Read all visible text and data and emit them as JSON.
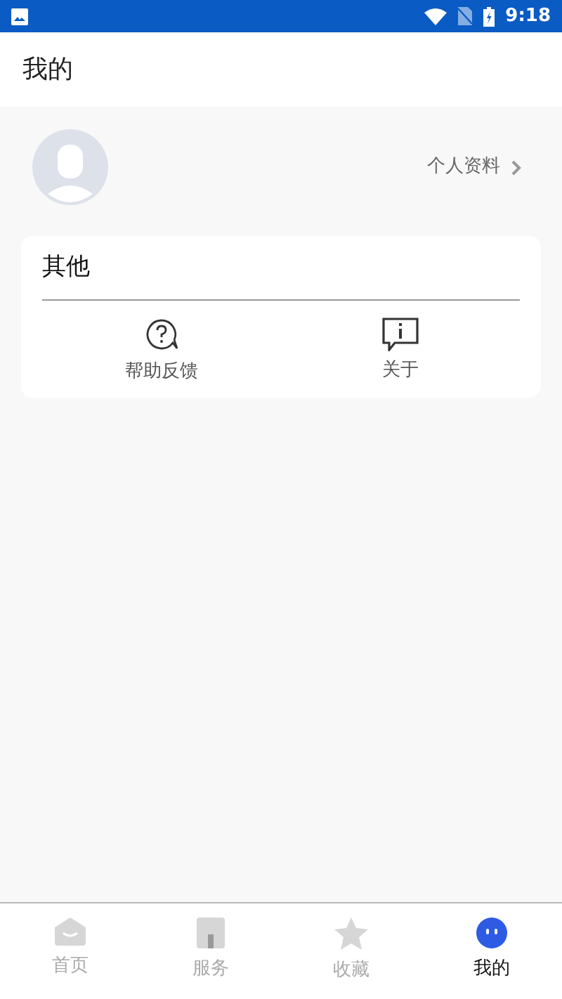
{
  "status_bar": {
    "time": "9:18"
  },
  "header": {
    "title": "我的"
  },
  "profile": {
    "link": "个人资料"
  },
  "section": {
    "title": "其他",
    "items": [
      {
        "kind": "help",
        "label": "帮助反馈"
      },
      {
        "kind": "about",
        "label": "关于"
      }
    ]
  },
  "tab_bar": [
    {
      "kind": "home",
      "label": "首页",
      "selected": false
    },
    {
      "kind": "service",
      "label": "服务",
      "selected": false
    },
    {
      "kind": "favorite",
      "label": "收藏",
      "selected": false
    },
    {
      "kind": "me",
      "label": "我的",
      "selected": true
    }
  ]
}
